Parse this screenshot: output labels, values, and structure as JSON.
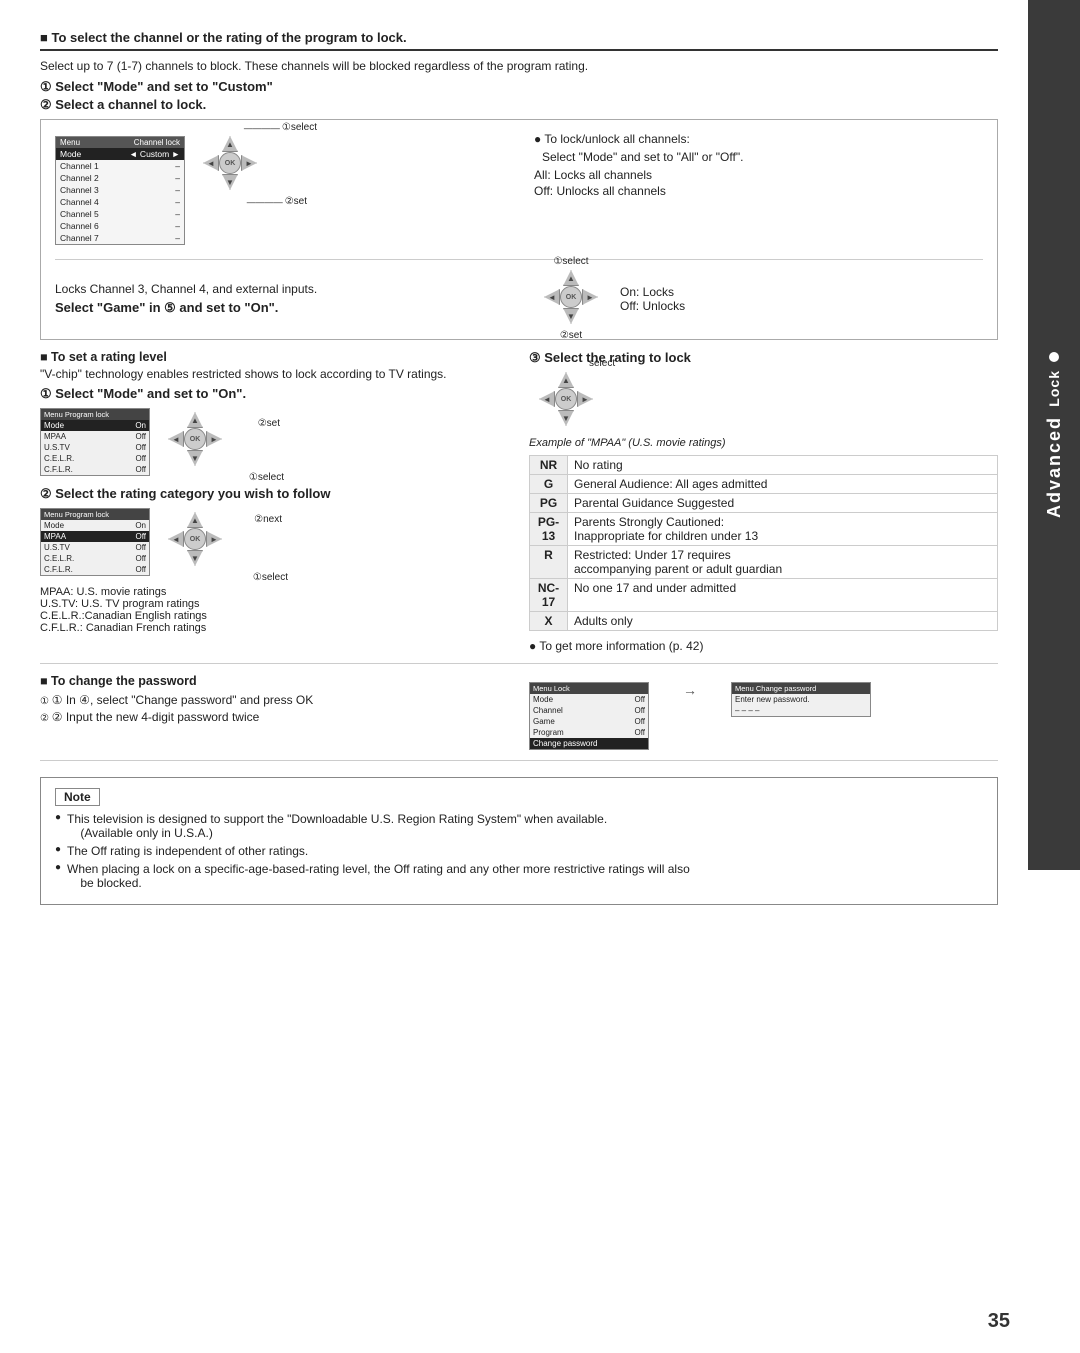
{
  "page": {
    "number": "35",
    "sidebar": {
      "dot": "●",
      "lock_label": "Lock",
      "advanced_label": "Advanced"
    }
  },
  "section_header": "■ To select the channel or the rating of the program to lock.",
  "top_desc": "Select up to 7 (1-7) channels to block. These channels will be blocked regardless of the program rating.",
  "step1_label": "① Select \"Mode\" and set to \"Custom\"",
  "step2_label": "② Select a channel to lock.",
  "channel_lock_screen": {
    "header_left": "Menu",
    "header_right": "Channel lock",
    "rows": [
      {
        "label": "Mode",
        "value": "◄ Custom ►",
        "highlight": true
      },
      {
        "label": "Channel 1",
        "value": "–"
      },
      {
        "label": "Channel 2",
        "value": "–"
      },
      {
        "label": "Channel 3",
        "value": "–"
      },
      {
        "label": "Channel 4",
        "value": "–"
      },
      {
        "label": "Channel 5",
        "value": "–"
      },
      {
        "label": "Channel 6",
        "value": "–"
      },
      {
        "label": "Channel 7",
        "value": "–"
      }
    ]
  },
  "select_annotation": "①select",
  "set_annotation": "②set",
  "right_col_lock_unlock": {
    "bullet": "● To lock/unlock all channels:",
    "desc": "Select \"Mode\" and set to \"All\" or \"Off\".",
    "all_desc": "All:  Locks all channels",
    "off_desc": "Off:  Unlocks all channels"
  },
  "game_section": {
    "intro": "Locks Channel 3, Channel 4, and external inputs.",
    "title": "Select \"Game\" in ⑤ and set to \"On\".",
    "select_annotation": "①select",
    "set_annotation": "②set",
    "on_locks": "On:  Locks",
    "off_unlocks": "Off:  Unlocks"
  },
  "rating_section": {
    "title": "■ To set a rating level",
    "desc": "\"V-chip\" technology enables restricted shows to lock according to TV ratings.",
    "step1": "① Select \"Mode\" and set to \"On\".",
    "program_lock_screen": {
      "header_left": "Menu",
      "header_right": "Program lock",
      "rows": [
        {
          "label": "Mode",
          "value": "On",
          "highlight": true
        },
        {
          "label": "MPAA",
          "value": "Off"
        },
        {
          "label": "U.S.TV",
          "value": "Off"
        },
        {
          "label": "C.E.L.R.",
          "value": "Off"
        },
        {
          "label": "C.F.L.R.",
          "value": "Off"
        }
      ]
    },
    "set_annotation": "②set",
    "select_annotation": "①select",
    "step2": "② Select the rating category you wish to follow",
    "program_lock_screen2": {
      "header_left": "Menu",
      "header_right": "Program lock",
      "rows": [
        {
          "label": "Mode",
          "value": "On"
        },
        {
          "label": "MPAA",
          "value": "Off",
          "highlight": true
        },
        {
          "label": "U.S.TV",
          "value": "Off"
        },
        {
          "label": "C.E.L.R.",
          "value": "Off"
        },
        {
          "label": "C.F.L.R.",
          "value": "Off"
        }
      ]
    },
    "next_annotation": "②next",
    "select_annotation2": "①select",
    "ratings_abbr": [
      "MPAA:   U.S. movie ratings",
      "U.S.TV:  U.S. TV program ratings",
      "C.E.L.R.:Canadian English ratings",
      "C.F.L.R.: Canadian French ratings"
    ]
  },
  "select_rating_section": {
    "title": "③ Select the rating to lock",
    "select_annotation": "select",
    "example": "Example of \"MPAA\" (U.S. movie ratings)",
    "ratings": [
      {
        "code": "NR",
        "desc": "No rating"
      },
      {
        "code": "G",
        "desc": "General Audience: All ages admitted"
      },
      {
        "code": "PG",
        "desc": "Parental Guidance Suggested"
      },
      {
        "code": "PG-\n13",
        "desc": "Parents Strongly Cautioned:\nInappropriate for children under 13"
      },
      {
        "code": "R",
        "desc": "Restricted: Under 17 requires\naccompanying parent or adult guardian"
      },
      {
        "code": "NC-\n17",
        "desc": "No one 17 and under admitted"
      },
      {
        "code": "X",
        "desc": "Adults only"
      }
    ],
    "more_info": "● To get more information (p. 42)"
  },
  "password_section": {
    "title": "■ To change the password",
    "step1": "① In ④, select \"Change password\" and press OK",
    "step2": "② Input the new 4-digit password twice",
    "lock_screen": {
      "header_left": "Menu",
      "header_right": "Lock",
      "rows": [
        {
          "label": "Mode",
          "value": "Off"
        },
        {
          "label": "Channel",
          "value": "Off"
        },
        {
          "label": "Game",
          "value": "Off"
        },
        {
          "label": "Program",
          "value": "Off"
        },
        {
          "label": "Change password",
          "value": "",
          "highlight": false
        }
      ]
    },
    "change_pw_screen": {
      "header_left": "Menu",
      "header_right": "Change password",
      "rows": [
        {
          "label": "Enter new password.",
          "value": ""
        },
        {
          "label": "– – – –",
          "value": ""
        }
      ]
    }
  },
  "note_section": {
    "title": "Note",
    "items": [
      "This television is designed to support the  \"Downloadable U.S. Region Rating System\" when available. (Available only in U.S.A.)",
      "The Off rating is independent of other ratings.",
      "When placing a lock on a specific-age-based-rating level, the Off rating and any other more restrictive ratings will also be blocked."
    ]
  }
}
